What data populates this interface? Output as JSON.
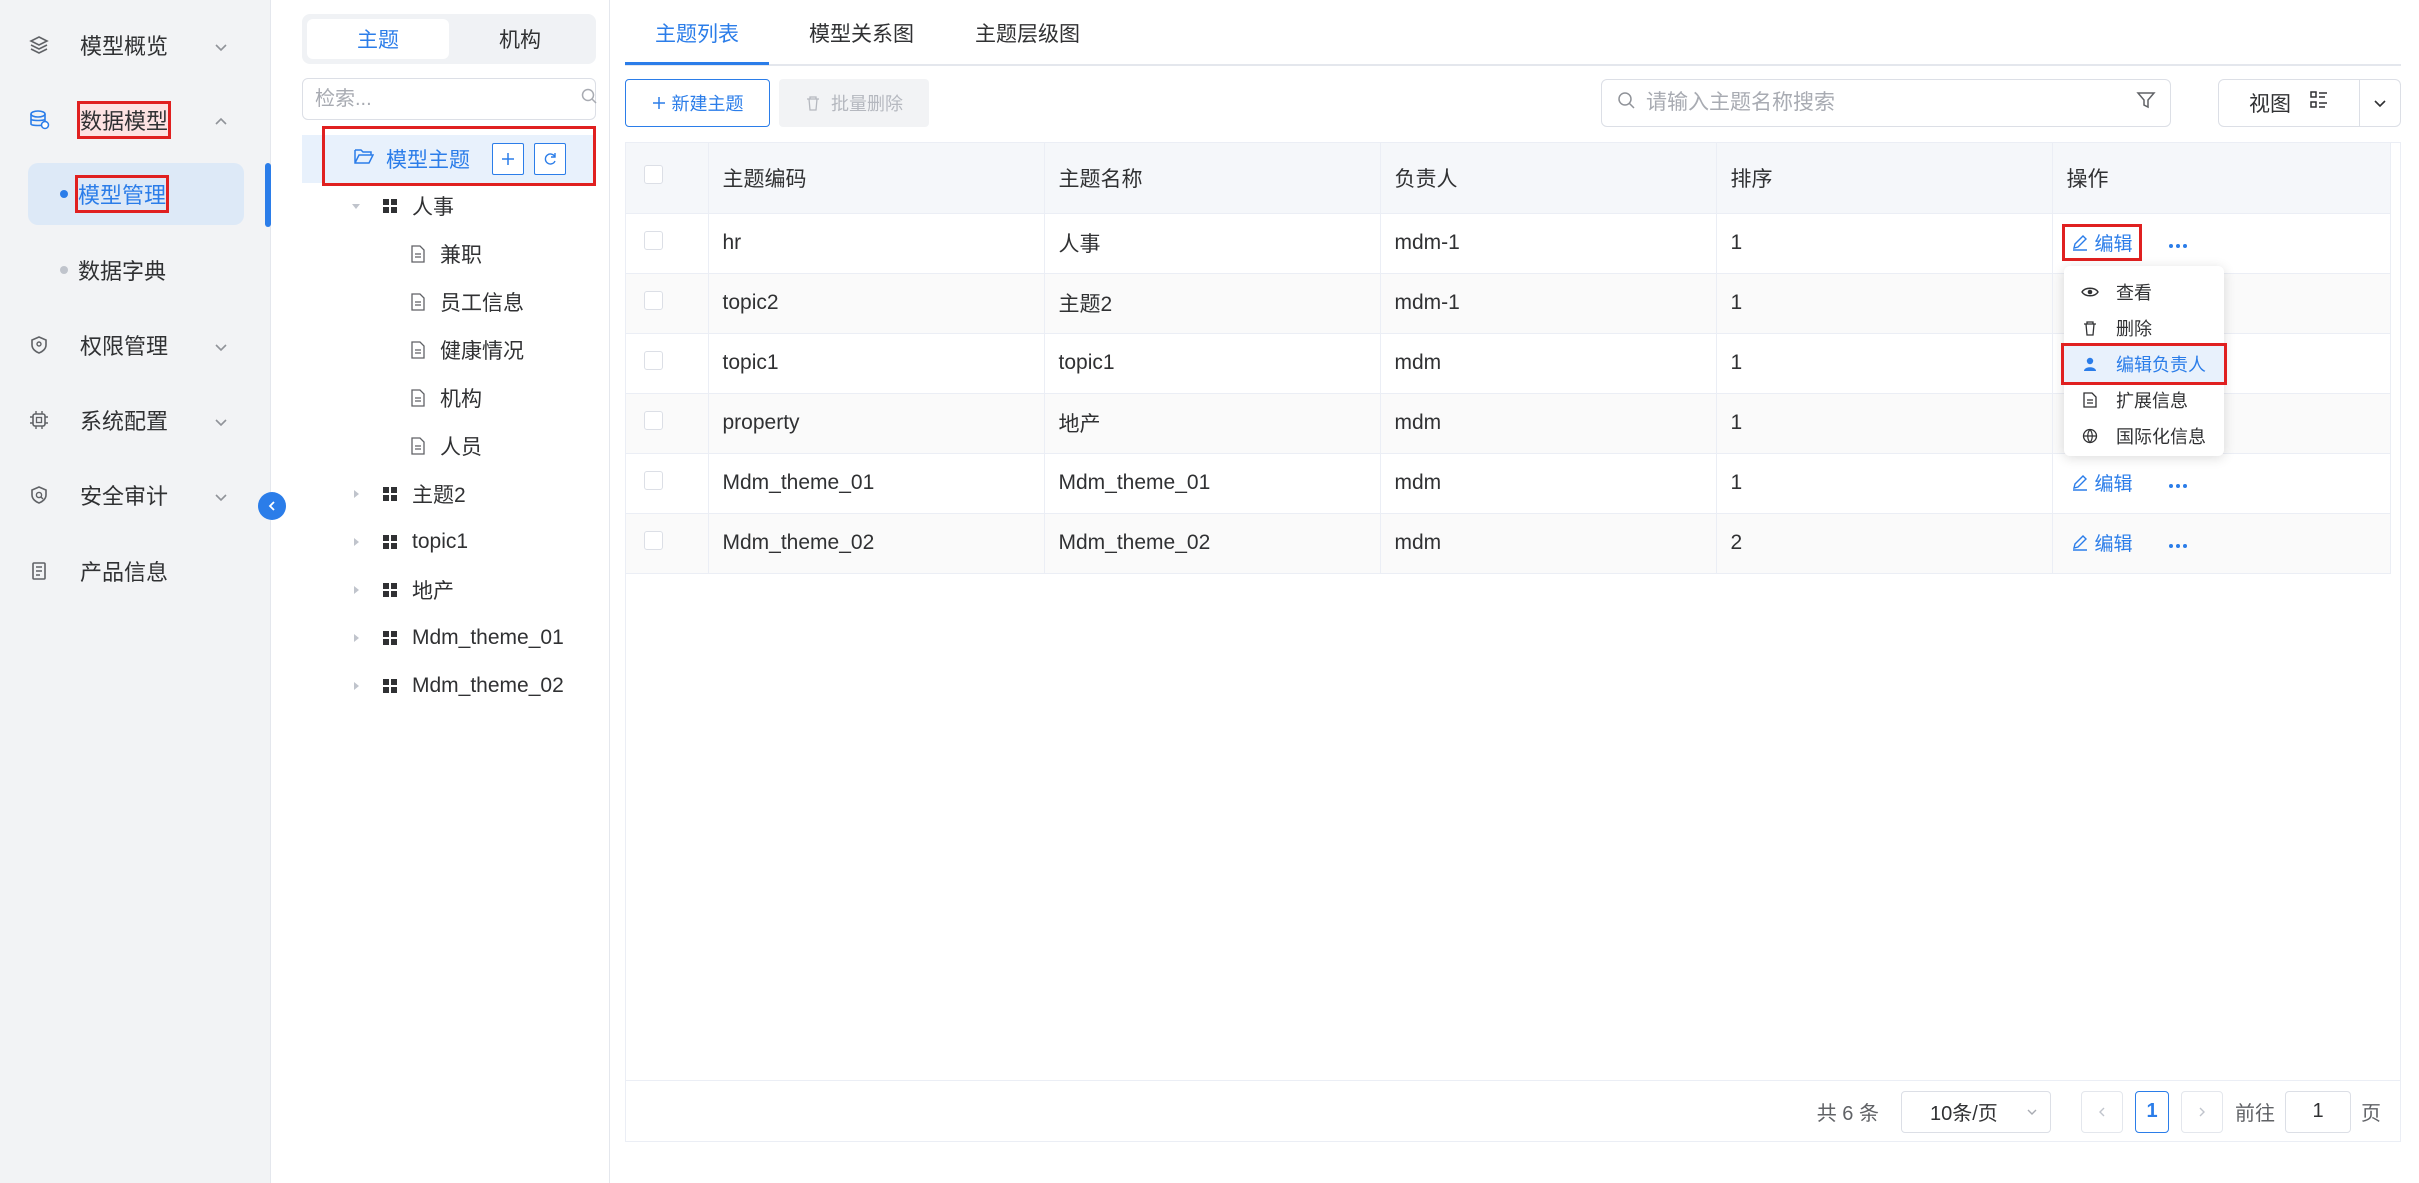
{
  "nav": {
    "items": [
      {
        "label": "模型概览",
        "icon": "layers-icon"
      },
      {
        "label": "数据模型",
        "icon": "database-icon"
      },
      {
        "label": "权限管理",
        "icon": "shield-icon"
      },
      {
        "label": "系统配置",
        "icon": "chip-icon"
      },
      {
        "label": "安全审计",
        "icon": "audit-shield-icon"
      },
      {
        "label": "产品信息",
        "icon": "document-list-icon"
      }
    ],
    "sub_items": [
      {
        "label": "模型管理"
      },
      {
        "label": "数据字典"
      }
    ]
  },
  "tree": {
    "segments": [
      "主题",
      "机构"
    ],
    "search_placeholder": "检索...",
    "root_label": "模型主题",
    "nodes": [
      {
        "label": "人事"
      },
      {
        "label": "兼职"
      },
      {
        "label": "员工信息"
      },
      {
        "label": "健康情况"
      },
      {
        "label": "机构"
      },
      {
        "label": "人员"
      },
      {
        "label": "主题2"
      },
      {
        "label": "topic1"
      },
      {
        "label": "地产"
      },
      {
        "label": "Mdm_theme_01"
      },
      {
        "label": "Mdm_theme_02"
      }
    ]
  },
  "tabs": [
    "主题列表",
    "模型关系图",
    "主题层级图"
  ],
  "toolbar": {
    "new_label": "新建主题",
    "batch_delete_label": "批量删除",
    "search_placeholder": "请输入主题名称搜索",
    "view_label": "视图"
  },
  "table": {
    "headers": [
      "主题编码",
      "主题名称",
      "负责人",
      "排序",
      "操作"
    ],
    "rows": [
      {
        "code": "hr",
        "name": "人事",
        "owner": "mdm-1",
        "order": "1"
      },
      {
        "code": "topic2",
        "name": "主题2",
        "owner": "mdm-1",
        "order": "1"
      },
      {
        "code": "topic1",
        "name": "topic1",
        "owner": "mdm",
        "order": "1"
      },
      {
        "code": "property",
        "name": "地产",
        "owner": "mdm",
        "order": "1"
      },
      {
        "code": "Mdm_theme_01",
        "name": "Mdm_theme_01",
        "owner": "mdm",
        "order": "1"
      },
      {
        "code": "Mdm_theme_02",
        "name": "Mdm_theme_02",
        "owner": "mdm",
        "order": "2"
      }
    ],
    "edit_label": "编辑"
  },
  "menu": {
    "items": [
      {
        "label": "查看",
        "icon": "eye-icon"
      },
      {
        "label": "删除",
        "icon": "trash-icon"
      },
      {
        "label": "编辑负责人",
        "icon": "user-icon"
      },
      {
        "label": "扩展信息",
        "icon": "file-icon"
      },
      {
        "label": "国际化信息",
        "icon": "globe-icon"
      }
    ]
  },
  "pager": {
    "total": "共 6 条",
    "page_size": "10条/页",
    "current": "1",
    "goto_prefix": "前往",
    "goto_value": "1",
    "goto_suffix": "页"
  },
  "colors": {
    "accent": "#2b7de9",
    "highlight": "#e02020"
  }
}
